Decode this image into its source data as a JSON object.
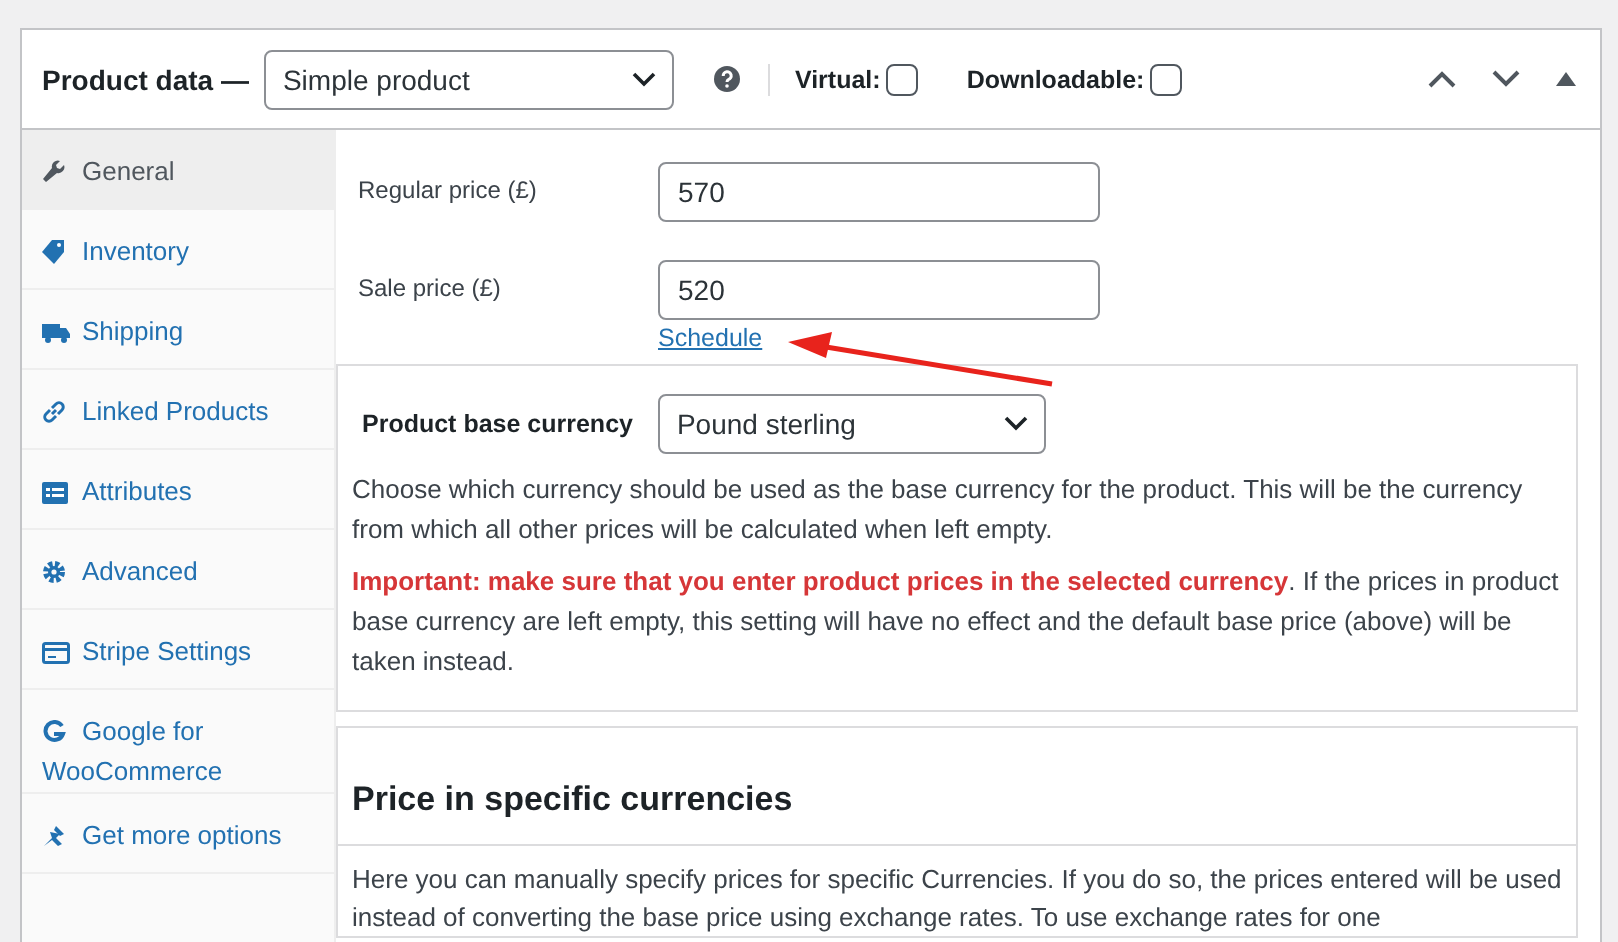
{
  "header": {
    "title": "Product data —",
    "product_type": "Simple product",
    "options": [
      {
        "label": "Virtual:",
        "checked": false
      },
      {
        "label": "Downloadable:",
        "checked": false
      }
    ]
  },
  "tabs": [
    {
      "label": "General",
      "selected": true
    },
    {
      "label": "Inventory",
      "selected": false
    },
    {
      "label": "Shipping",
      "selected": false
    },
    {
      "label": "Linked Products",
      "selected": false
    },
    {
      "label": "Attributes",
      "selected": false
    },
    {
      "label": "Advanced",
      "selected": false
    },
    {
      "label": "Stripe Settings",
      "selected": false
    },
    {
      "label": "Google for WooCommerce",
      "selected": false
    },
    {
      "label": "Get more options",
      "selected": false
    }
  ],
  "pricing": {
    "fields": [
      {
        "label": "Regular price (£)",
        "value": "570"
      },
      {
        "label": "Sale price (£)",
        "value": "520"
      }
    ],
    "schedule_link": "Schedule"
  },
  "base_currency": {
    "label": "Product base currency",
    "value": "Pound sterling",
    "description": "Choose which currency should be used as the base currency for the product. This will be the currency from which all other prices will be calculated when left empty.",
    "important": "Important: make sure that you enter product prices in the selected currency",
    "important_rest": ". If the prices in product base currency are left empty, this setting will have no effect and the default base price (above) will be taken instead."
  },
  "specific": {
    "heading": "Price in specific currencies",
    "text": "Here you can manually specify prices for specific Currencies. If you do so, the prices entered will be used instead of converting the base price using exchange rates. To use exchange rates for one"
  }
}
